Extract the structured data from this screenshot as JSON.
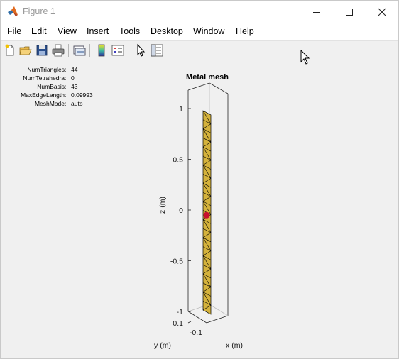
{
  "window": {
    "title": "Figure 1",
    "controls": [
      "minimize",
      "maximize",
      "close"
    ]
  },
  "menubar": {
    "items": [
      "File",
      "Edit",
      "View",
      "Insert",
      "Tools",
      "Desktop",
      "Window",
      "Help"
    ]
  },
  "toolbar": {
    "buttons": [
      "new-figure-icon",
      "open-file-icon",
      "save-icon",
      "print-icon",
      "link-plot-icon",
      "colorbar-icon",
      "legend-icon",
      "pointer-icon",
      "property-inspector-icon"
    ]
  },
  "mesh_info": [
    {
      "key": "NumTriangles",
      "value": "44"
    },
    {
      "key": "NumTetrahedra",
      "value": "0"
    },
    {
      "key": "NumBasis",
      "value": "43"
    },
    {
      "key": "MaxEdgeLength",
      "value": "0.09993"
    },
    {
      "key": "MeshMode",
      "value": "auto"
    }
  ],
  "plot": {
    "title": "Metal mesh",
    "zlabel": "z (m)",
    "ylabel": "y (m)",
    "xlabel": "x (m)",
    "z_ticks": [
      "1",
      "0.5",
      "0",
      "-0.5",
      "-1"
    ],
    "y_ticks": [
      "0.1"
    ],
    "x_ticks": [
      "-0.1"
    ]
  },
  "chart_data": {
    "type": "mesh3d",
    "title": "Metal mesh",
    "zlabel": "z (m)",
    "ylabel": "y (m)",
    "xlabel": "x (m)",
    "zlim": [
      -1,
      1
    ],
    "z_ticks": [
      1,
      0.5,
      0,
      -0.5,
      -1
    ],
    "y_ticks": [
      0.1
    ],
    "x_ticks": [
      -0.1
    ],
    "strip_segments": 22,
    "feed_z": -0.03,
    "colors": {
      "mesh_fill": "#d4b23c",
      "mesh_edge": "#000000",
      "feed": "#c8102e"
    }
  }
}
